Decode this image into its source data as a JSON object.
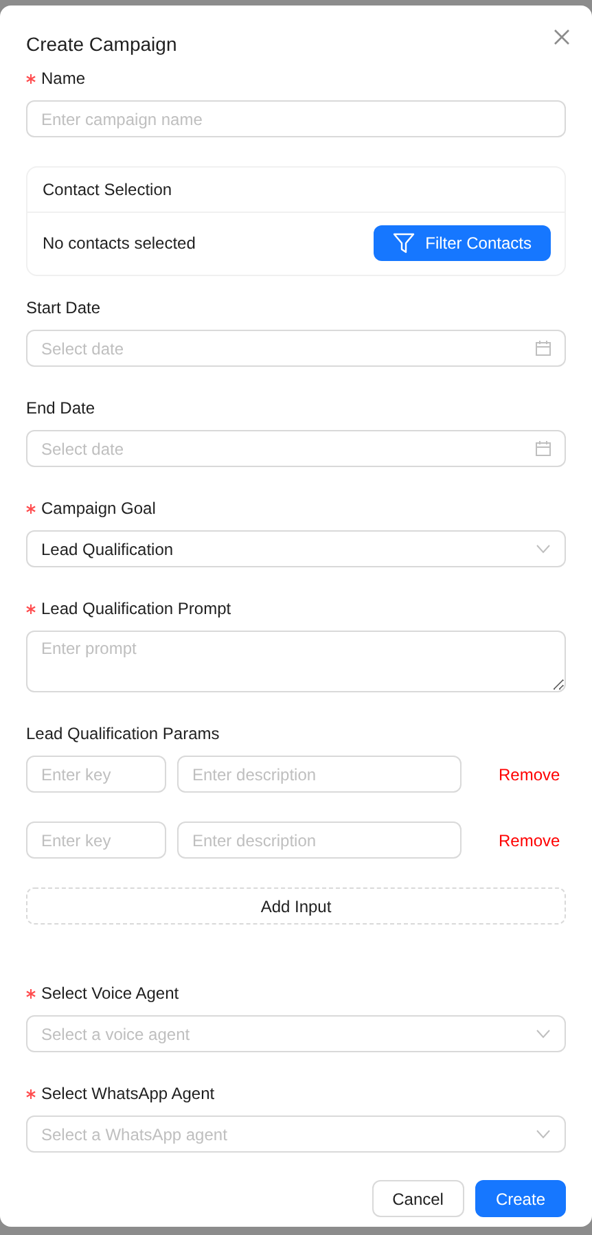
{
  "dialog": {
    "title": "Create Campaign"
  },
  "fields": [
    {
      "kind": "text",
      "label": "Name",
      "required": true,
      "placeholder": "Enter campaign name"
    },
    {
      "kind": "contacts",
      "title": "Contact Selection",
      "status": "No contacts selected",
      "button": "Filter Contacts"
    },
    {
      "kind": "date",
      "label": "Start Date",
      "required": false,
      "placeholder": "Select date"
    },
    {
      "kind": "date",
      "label": "End Date",
      "required": false,
      "placeholder": "Select date"
    },
    {
      "kind": "select",
      "label": "Campaign Goal",
      "required": true,
      "value": "Lead Qualification"
    },
    {
      "kind": "textarea",
      "label": "Lead Qualification Prompt",
      "required": true,
      "placeholder": "Enter prompt"
    },
    {
      "kind": "params",
      "label": "Lead Qualification Params",
      "required": false,
      "add_button": "Add Input",
      "rows": [
        {
          "key_placeholder": "Enter key",
          "description_placeholder": "Enter description",
          "remove": "Remove"
        },
        {
          "key_placeholder": "Enter key",
          "description_placeholder": "Enter description",
          "remove": "Remove"
        }
      ]
    },
    {
      "kind": "select",
      "label": "Select Voice Agent",
      "required": true,
      "placeholder": "Select a voice agent"
    },
    {
      "kind": "select",
      "label": "Select WhatsApp Agent",
      "required": true,
      "placeholder": "Select a WhatsApp agent"
    }
  ],
  "buttons": [
    {
      "label": "Cancel",
      "kind": "default"
    },
    {
      "label": "Create",
      "kind": "primary"
    }
  ]
}
